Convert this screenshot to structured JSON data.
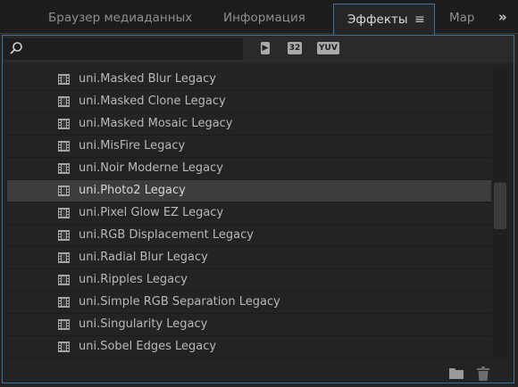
{
  "tabs": [
    {
      "label": "Браузер медиаданных",
      "active": false
    },
    {
      "label": "Информация",
      "active": false
    },
    {
      "label": "Эффекты",
      "active": true
    },
    {
      "label": "Мар",
      "active": false
    }
  ],
  "tab_menu_glyph": "≡",
  "tab_overflow_glyph": "»",
  "search": {
    "value": "",
    "placeholder": "",
    "icon": "search-icon"
  },
  "filters": [
    {
      "icon": "accelerated-effects-icon",
      "label": "▶"
    },
    {
      "icon": "32-bit-color-icon",
      "label": "32"
    },
    {
      "icon": "yuv-effects-icon",
      "label": "YUV"
    }
  ],
  "effects": [
    {
      "label": "uni.Masked Blur Legacy",
      "selected": false
    },
    {
      "label": "uni.Masked Clone Legacy",
      "selected": false
    },
    {
      "label": "uni.Masked Mosaic Legacy",
      "selected": false
    },
    {
      "label": "uni.MisFire Legacy",
      "selected": false
    },
    {
      "label": "uni.Noir Moderne Legacy",
      "selected": false
    },
    {
      "label": "uni.Photo2 Legacy",
      "selected": true
    },
    {
      "label": "uni.Pixel Glow EZ Legacy",
      "selected": false
    },
    {
      "label": "uni.RGB Displacement Legacy",
      "selected": false
    },
    {
      "label": "uni.Radial Blur Legacy",
      "selected": false
    },
    {
      "label": "uni.Ripples Legacy",
      "selected": false
    },
    {
      "label": "uni.Simple RGB Separation Legacy",
      "selected": false
    },
    {
      "label": "uni.Singularity Legacy",
      "selected": false
    },
    {
      "label": "uni.Sobel Edges Legacy",
      "selected": false
    }
  ],
  "effect_icon": "video-effect-icon",
  "bottom_actions": [
    {
      "icon": "new-bin-folder-icon"
    },
    {
      "icon": "trash-icon"
    }
  ],
  "colors": {
    "panel_bg": "#232323",
    "selected_row": "#3d3d3d",
    "focus_border": "#3f6ea3",
    "text": "#b8b8b8"
  }
}
